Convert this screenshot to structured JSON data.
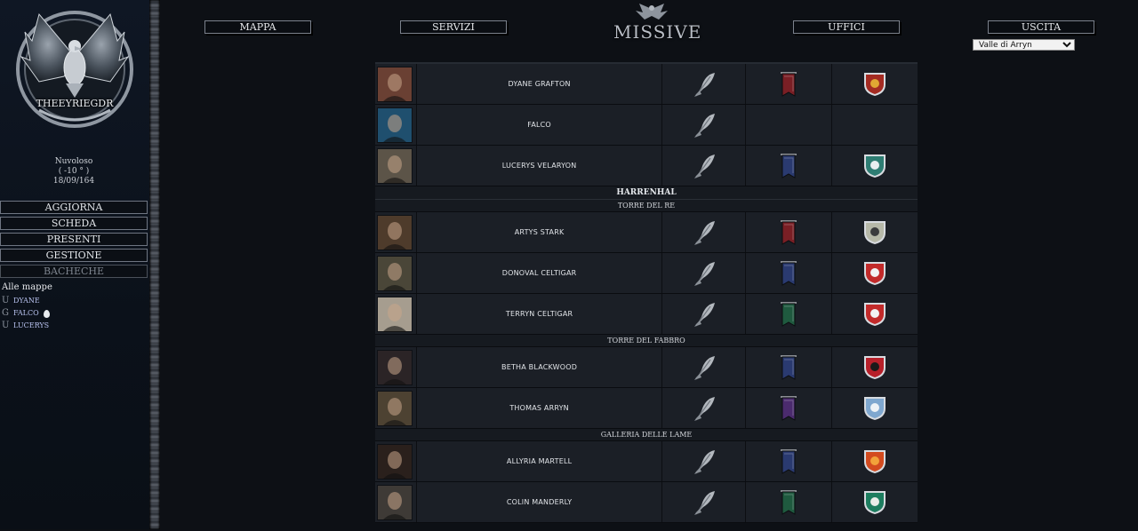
{
  "sidebar": {
    "logo_text": "THEEYRIEGDR",
    "weather": {
      "condition": "Nuvoloso",
      "temperature": "( -10 ° )",
      "date": "18/09/164"
    },
    "menu": [
      {
        "label": "AGGIORNA",
        "dim": false
      },
      {
        "label": "SCHEDA",
        "dim": false
      },
      {
        "label": "PRESENTI",
        "dim": false
      },
      {
        "label": "GESTIONE",
        "dim": false
      },
      {
        "label": "BACHECHE",
        "dim": true
      }
    ],
    "maps_title": "Alle mappe",
    "maps": [
      {
        "tag": "U",
        "name": "DYANE",
        "drop": false
      },
      {
        "tag": "G",
        "name": "FALCO",
        "drop": true
      },
      {
        "tag": "U",
        "name": "LUCERYS",
        "drop": false
      }
    ]
  },
  "topnav": {
    "mappa": "MAPPA",
    "servizi": "SERVIZI",
    "title": "MISSIVE",
    "uffici": "UFFICI",
    "uscita": "USCITA"
  },
  "region_select": {
    "selected": "Valle di Arryn"
  },
  "roster": [
    {
      "kind": "row",
      "name": "DYANE GRAFTON",
      "avatar": "#6a4033",
      "banner": "#7a1f25",
      "shield": {
        "fill": "#a42b22",
        "charge": "#e1a733"
      }
    },
    {
      "kind": "row",
      "name": "FALCO",
      "avatar": "#1f4f6e",
      "banner": "",
      "shield": null
    },
    {
      "kind": "row",
      "name": "LUCERYS VELARYON",
      "avatar": "#5c5448",
      "banner": "#2a3a70",
      "shield": {
        "fill": "#2e7d73",
        "charge": "#e8eef0"
      }
    },
    {
      "kind": "section",
      "label": "HARRENHAL"
    },
    {
      "kind": "sub",
      "label": "TORRE DEL RE"
    },
    {
      "kind": "row",
      "name": "ARTYS STARK",
      "avatar": "#4e3b2b",
      "banner": "#7a1f25",
      "shield": {
        "fill": "#b6b8a8",
        "charge": "#3a3b3d"
      }
    },
    {
      "kind": "row",
      "name": "DONOVAL CELTIGAR",
      "avatar": "#4a4638",
      "banner": "#2a3a70",
      "shield": {
        "fill": "#c22a2a",
        "charge": "#f2f2f2"
      }
    },
    {
      "kind": "row",
      "name": "TERRYN CELTIGAR",
      "avatar": "#a69d8f",
      "banner": "#1f5a3f",
      "shield": {
        "fill": "#c22a2a",
        "charge": "#f2f2f2"
      }
    },
    {
      "kind": "sub",
      "label": "TORRE DEL FABBRO"
    },
    {
      "kind": "row",
      "name": "BETHA BLACKWOOD",
      "avatar": "#2b2426",
      "banner": "#2a3a70",
      "shield": {
        "fill": "#b7202a",
        "charge": "#1a1a1a"
      }
    },
    {
      "kind": "row",
      "name": "THOMAS ARRYN",
      "avatar": "#4d4232",
      "banner": "#4b2b6e",
      "shield": {
        "fill": "#7fa7cf",
        "charge": "#eef2f6"
      }
    },
    {
      "kind": "sub",
      "label": "GALLERIA DELLE LAME"
    },
    {
      "kind": "row",
      "name": "ALLYRIA MARTELL",
      "avatar": "#2a201c",
      "banner": "#2a3a70",
      "shield": {
        "fill": "#d34b1f",
        "charge": "#f2a23a"
      }
    },
    {
      "kind": "row",
      "name": "COLIN MANDERLY",
      "avatar": "#3e3a36",
      "banner": "#1f5a3f",
      "shield": {
        "fill": "#1d7d5f",
        "charge": "#e9ede9"
      }
    }
  ]
}
